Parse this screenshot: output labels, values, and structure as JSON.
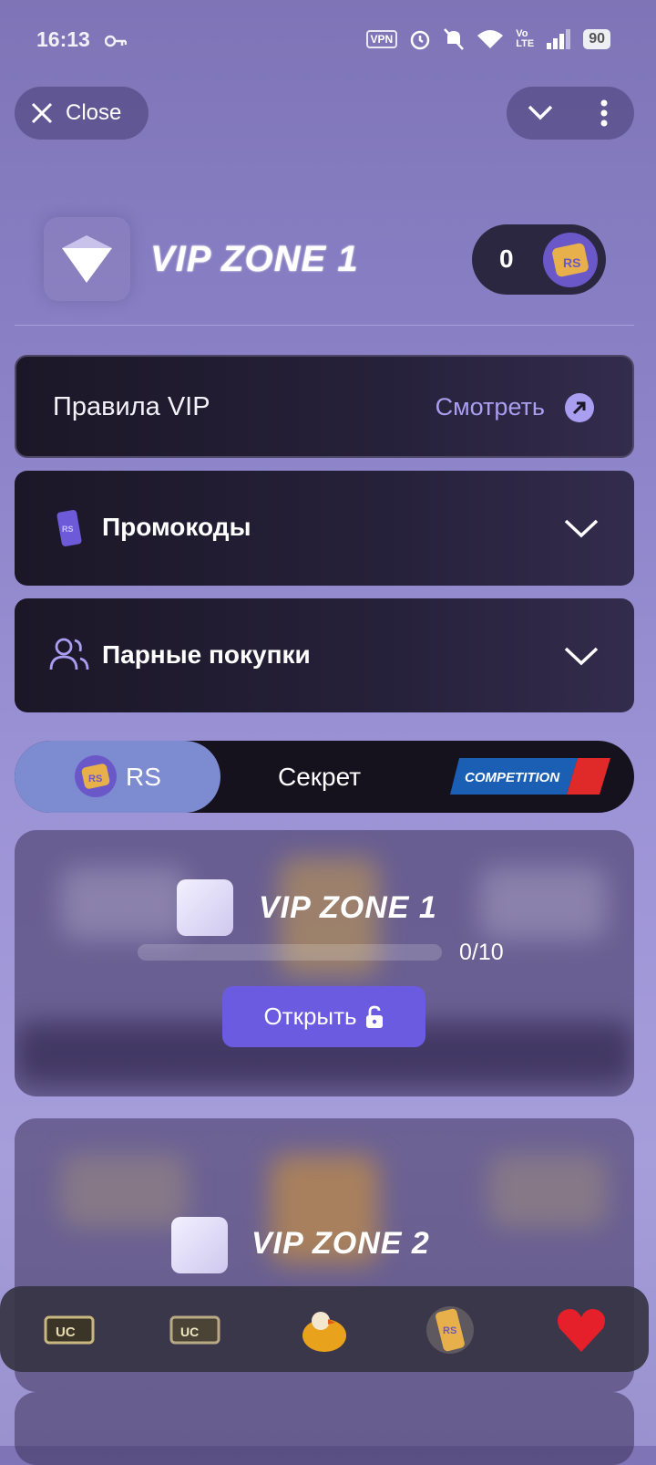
{
  "status": {
    "time": "16:13",
    "vpn": "VPN",
    "net": "Vo LTE",
    "battery": "90"
  },
  "header": {
    "close_label": "Close",
    "title": "VIP ZONE 1",
    "balance": "0"
  },
  "rules": {
    "label": "Правила VIP",
    "link": "Смотреть"
  },
  "accordions": {
    "promo": "Промокоды",
    "pairs": "Парные покупки"
  },
  "tabs": {
    "rs": "RS",
    "secret": "Секрет",
    "competition": "COMPETITION"
  },
  "zones": [
    {
      "title": "VIP ZONE 1",
      "progress": "0/10",
      "progress_value": 0.0,
      "button": "Открыть"
    },
    {
      "title": "VIP ZONE 2"
    }
  ],
  "bottom_nav": [
    "uc-ticket-icon",
    "uc-voucher-icon",
    "chicken-icon",
    "rs-ticket-icon",
    "heart-icon"
  ],
  "colors": {
    "accent": "#6b5be0",
    "link": "#a99ef0",
    "card": "#1b1727",
    "heart": "#e5202a"
  }
}
